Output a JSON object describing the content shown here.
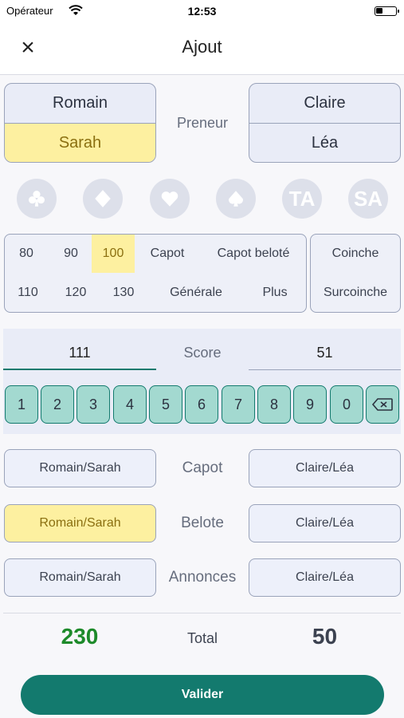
{
  "status_bar": {
    "carrier": "Opérateur",
    "time": "12:53"
  },
  "header": {
    "title": "Ajout",
    "close_label": "×"
  },
  "teams": {
    "left": {
      "player1": "Romain",
      "player2": "Sarah",
      "selected": "Sarah"
    },
    "right": {
      "player1": "Claire",
      "player2": "Léa"
    },
    "middle_label": "Preneur"
  },
  "suits": [
    "clubs-icon",
    "diamonds-icon",
    "hearts-icon",
    "spades-icon",
    "TA",
    "SA"
  ],
  "bids": {
    "row1": [
      "80",
      "90",
      "100",
      "Capot",
      "Capot beloté"
    ],
    "row2": [
      "110",
      "120",
      "130",
      "Générale",
      "Plus"
    ],
    "selected": "100",
    "coinche": [
      "Coinche",
      "Surcoinche"
    ]
  },
  "score": {
    "left": "111",
    "label": "Score",
    "right": "51"
  },
  "keypad": [
    "1",
    "2",
    "3",
    "4",
    "5",
    "6",
    "7",
    "8",
    "9",
    "0"
  ],
  "rows": {
    "capot": {
      "label": "Capot",
      "left": "Romain/Sarah",
      "right": "Claire/Léa"
    },
    "belote": {
      "label": "Belote",
      "left": "Romain/Sarah",
      "right": "Claire/Léa",
      "selected": "left"
    },
    "annonces": {
      "label": "Annonces",
      "left": "Romain/Sarah",
      "right": "Claire/Léa"
    }
  },
  "total": {
    "left": "230",
    "label": "Total",
    "right": "50"
  },
  "validate_label": "Valider",
  "colors": {
    "accent": "#137a6e",
    "selected": "#fdf0a0",
    "total_left": "#1d8a2a"
  }
}
